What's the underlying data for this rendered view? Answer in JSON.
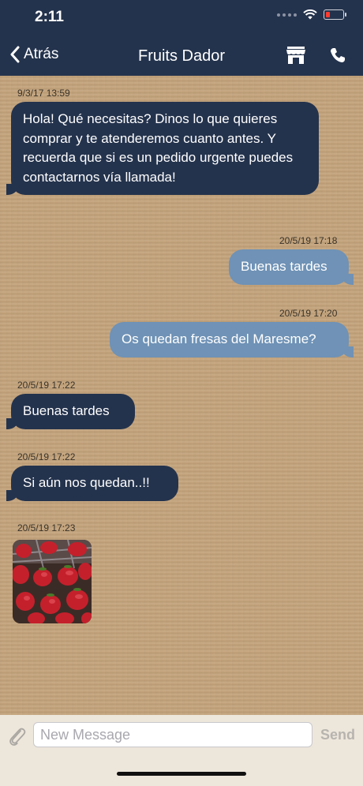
{
  "status": {
    "time": "2:11"
  },
  "nav": {
    "back_label": "Atrás",
    "title": "Fruits Dador"
  },
  "messages": [
    {
      "timestamp": "9/3/17 13:59",
      "text": "Hola! Qué necesitas? Dinos lo que quieres comprar y te atenderemos cuanto antes. Y recuerda que si es un pedido urgente puedes contactarnos vía llamada!",
      "direction": "incoming"
    },
    {
      "timestamp": "20/5/19 17:18",
      "text": "Buenas tardes",
      "direction": "outgoing"
    },
    {
      "timestamp": "20/5/19 17:20",
      "text": "Os quedan fresas del Maresme?",
      "direction": "outgoing"
    },
    {
      "timestamp": "20/5/19 17:22",
      "text": "Buenas tardes",
      "direction": "incoming"
    },
    {
      "timestamp": "20/5/19 17:22",
      "text": "Si aún nos quedan..!!",
      "direction": "incoming"
    },
    {
      "timestamp": "20/5/19 17:23",
      "image": "strawberries-photo",
      "direction": "incoming"
    }
  ],
  "composer": {
    "placeholder": "New Message",
    "send_label": "Send"
  },
  "icons": [
    "chevron-left-icon",
    "store-icon",
    "phone-icon",
    "paperclip-icon",
    "wifi-icon",
    "battery-icon",
    "signal-icon"
  ],
  "colors": {
    "header": "#24334d",
    "incoming_bubble": "#24334d",
    "outgoing_bubble": "#6f92b6",
    "background": "#c4a47c",
    "composer": "#ede6db"
  }
}
